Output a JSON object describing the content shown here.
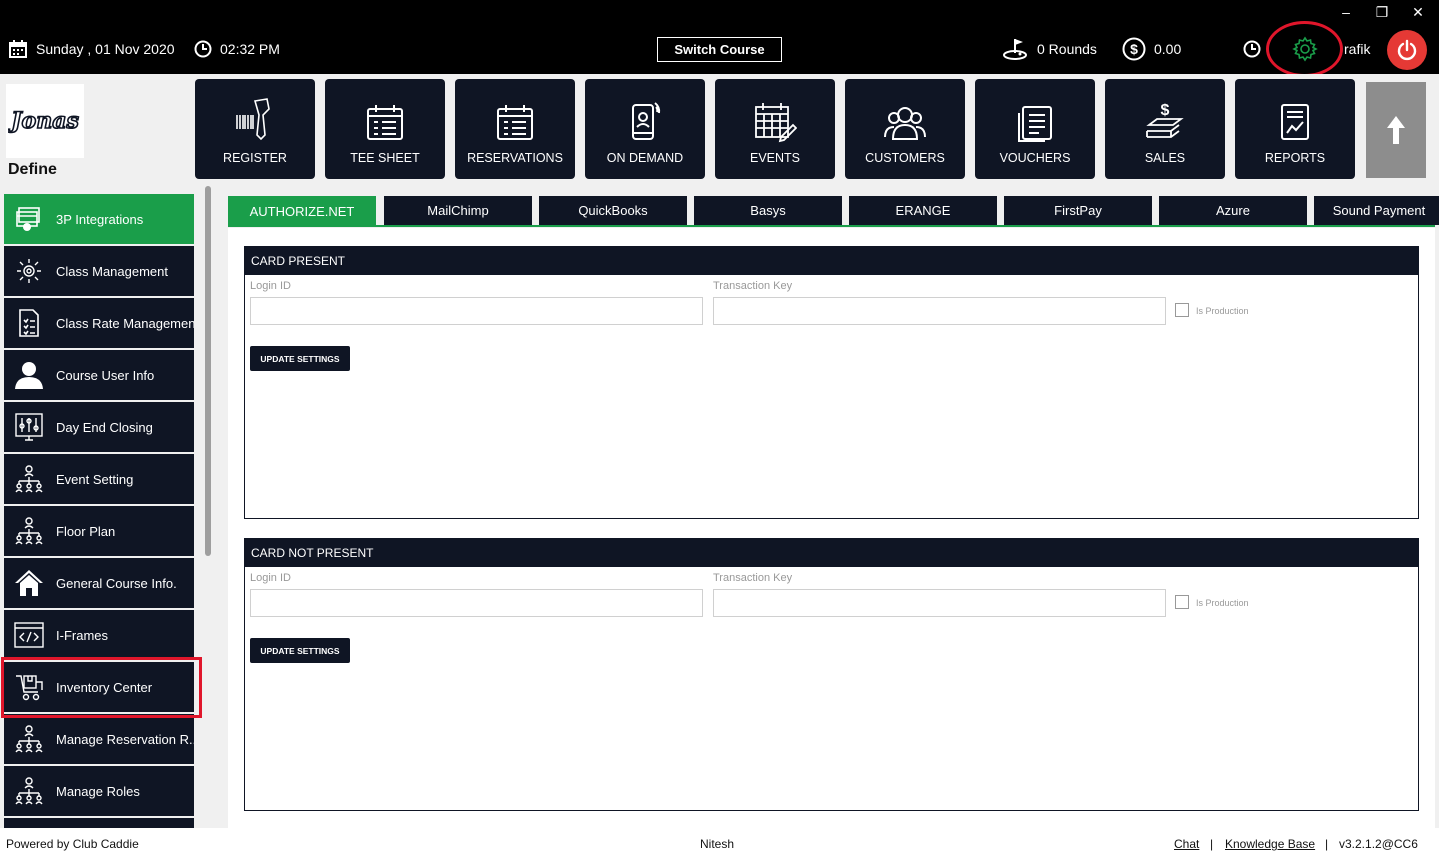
{
  "window": {
    "minimize_icon": "minimize-icon",
    "restore_icon": "restore-icon",
    "close_icon": "close-icon"
  },
  "topbar": {
    "date": "Sunday ,  01 Nov 2020",
    "time": "02:32 PM",
    "switch_course": "Switch Course",
    "rounds": "0 Rounds",
    "amount": "0.00",
    "user": "rafik"
  },
  "header": {
    "define_label": "Define",
    "logo_text": "Jonas",
    "nav": [
      {
        "label": "REGISTER",
        "icon": "barcode-scanner-icon"
      },
      {
        "label": "TEE SHEET",
        "icon": "tee-sheet-icon"
      },
      {
        "label": "RESERVATIONS",
        "icon": "calendar-list-icon"
      },
      {
        "label": "ON DEMAND",
        "icon": "mobile-icon"
      },
      {
        "label": "EVENTS",
        "icon": "events-calendar-icon"
      },
      {
        "label": "CUSTOMERS",
        "icon": "customers-icon"
      },
      {
        "label": "VOUCHERS",
        "icon": "vouchers-icon"
      },
      {
        "label": "SALES",
        "icon": "sales-icon"
      },
      {
        "label": "REPORTS",
        "icon": "reports-icon"
      }
    ]
  },
  "sidebar": {
    "items": [
      {
        "label": "3P Integrations",
        "active": true
      },
      {
        "label": "Class Management"
      },
      {
        "label": "Class Rate Management"
      },
      {
        "label": "Course User Info"
      },
      {
        "label": "Day End Closing"
      },
      {
        "label": "Event Setting"
      },
      {
        "label": "Floor Plan"
      },
      {
        "label": "General Course Info."
      },
      {
        "label": "I-Frames"
      },
      {
        "label": "Inventory Center"
      },
      {
        "label": "Manage Reservation R..."
      },
      {
        "label": "Manage Roles"
      }
    ]
  },
  "tabs": [
    "AUTHORIZE.NET",
    "MailChimp",
    "QuickBooks",
    "Basys",
    "ERANGE",
    "FirstPay",
    "Azure",
    "Sound Payment"
  ],
  "panels": [
    {
      "title": "CARD PRESENT",
      "login_label": "Login ID",
      "key_label": "Transaction Key",
      "production_label": "Is Production",
      "button": "UPDATE SETTINGS"
    },
    {
      "title": "CARD NOT PRESENT",
      "login_label": "Login ID",
      "key_label": "Transaction Key",
      "production_label": "Is Production",
      "button": "UPDATE SETTINGS"
    }
  ],
  "footer": {
    "powered": "Powered by Club Caddie",
    "user": "Nitesh",
    "chat": "Chat",
    "sep1": "|",
    "kb": "Knowledge Base",
    "sep2": "|",
    "version": "v3.2.1.2@CC6"
  },
  "colors": {
    "dark": "#0f1524",
    "green": "#1a9e4a",
    "red": "#e53935",
    "annotation": "#e0162b"
  }
}
